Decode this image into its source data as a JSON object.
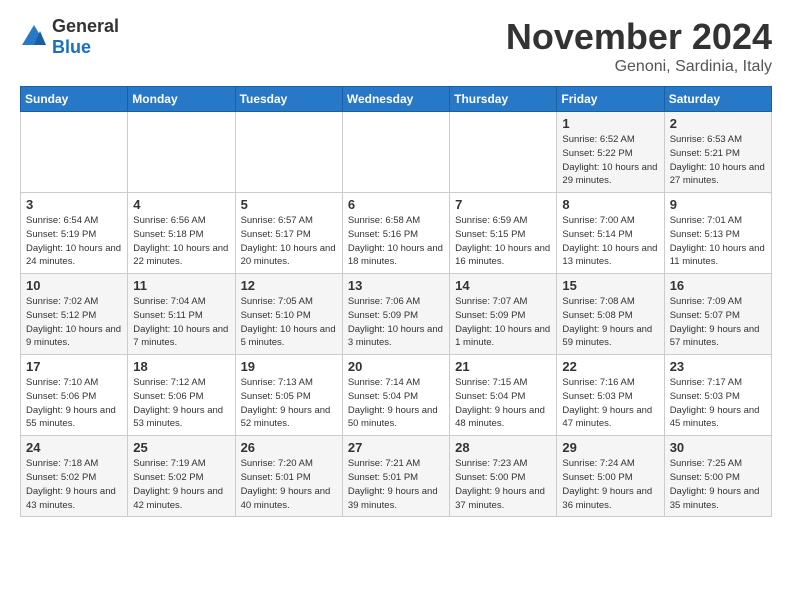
{
  "logo": {
    "general": "General",
    "blue": "Blue"
  },
  "title": "November 2024",
  "location": "Genoni, Sardinia, Italy",
  "days_of_week": [
    "Sunday",
    "Monday",
    "Tuesday",
    "Wednesday",
    "Thursday",
    "Friday",
    "Saturday"
  ],
  "weeks": [
    [
      {
        "day": "",
        "content": ""
      },
      {
        "day": "",
        "content": ""
      },
      {
        "day": "",
        "content": ""
      },
      {
        "day": "",
        "content": ""
      },
      {
        "day": "",
        "content": ""
      },
      {
        "day": "1",
        "content": "Sunrise: 6:52 AM\nSunset: 5:22 PM\nDaylight: 10 hours and 29 minutes."
      },
      {
        "day": "2",
        "content": "Sunrise: 6:53 AM\nSunset: 5:21 PM\nDaylight: 10 hours and 27 minutes."
      }
    ],
    [
      {
        "day": "3",
        "content": "Sunrise: 6:54 AM\nSunset: 5:19 PM\nDaylight: 10 hours and 24 minutes."
      },
      {
        "day": "4",
        "content": "Sunrise: 6:56 AM\nSunset: 5:18 PM\nDaylight: 10 hours and 22 minutes."
      },
      {
        "day": "5",
        "content": "Sunrise: 6:57 AM\nSunset: 5:17 PM\nDaylight: 10 hours and 20 minutes."
      },
      {
        "day": "6",
        "content": "Sunrise: 6:58 AM\nSunset: 5:16 PM\nDaylight: 10 hours and 18 minutes."
      },
      {
        "day": "7",
        "content": "Sunrise: 6:59 AM\nSunset: 5:15 PM\nDaylight: 10 hours and 16 minutes."
      },
      {
        "day": "8",
        "content": "Sunrise: 7:00 AM\nSunset: 5:14 PM\nDaylight: 10 hours and 13 minutes."
      },
      {
        "day": "9",
        "content": "Sunrise: 7:01 AM\nSunset: 5:13 PM\nDaylight: 10 hours and 11 minutes."
      }
    ],
    [
      {
        "day": "10",
        "content": "Sunrise: 7:02 AM\nSunset: 5:12 PM\nDaylight: 10 hours and 9 minutes."
      },
      {
        "day": "11",
        "content": "Sunrise: 7:04 AM\nSunset: 5:11 PM\nDaylight: 10 hours and 7 minutes."
      },
      {
        "day": "12",
        "content": "Sunrise: 7:05 AM\nSunset: 5:10 PM\nDaylight: 10 hours and 5 minutes."
      },
      {
        "day": "13",
        "content": "Sunrise: 7:06 AM\nSunset: 5:09 PM\nDaylight: 10 hours and 3 minutes."
      },
      {
        "day": "14",
        "content": "Sunrise: 7:07 AM\nSunset: 5:09 PM\nDaylight: 10 hours and 1 minute."
      },
      {
        "day": "15",
        "content": "Sunrise: 7:08 AM\nSunset: 5:08 PM\nDaylight: 9 hours and 59 minutes."
      },
      {
        "day": "16",
        "content": "Sunrise: 7:09 AM\nSunset: 5:07 PM\nDaylight: 9 hours and 57 minutes."
      }
    ],
    [
      {
        "day": "17",
        "content": "Sunrise: 7:10 AM\nSunset: 5:06 PM\nDaylight: 9 hours and 55 minutes."
      },
      {
        "day": "18",
        "content": "Sunrise: 7:12 AM\nSunset: 5:06 PM\nDaylight: 9 hours and 53 minutes."
      },
      {
        "day": "19",
        "content": "Sunrise: 7:13 AM\nSunset: 5:05 PM\nDaylight: 9 hours and 52 minutes."
      },
      {
        "day": "20",
        "content": "Sunrise: 7:14 AM\nSunset: 5:04 PM\nDaylight: 9 hours and 50 minutes."
      },
      {
        "day": "21",
        "content": "Sunrise: 7:15 AM\nSunset: 5:04 PM\nDaylight: 9 hours and 48 minutes."
      },
      {
        "day": "22",
        "content": "Sunrise: 7:16 AM\nSunset: 5:03 PM\nDaylight: 9 hours and 47 minutes."
      },
      {
        "day": "23",
        "content": "Sunrise: 7:17 AM\nSunset: 5:03 PM\nDaylight: 9 hours and 45 minutes."
      }
    ],
    [
      {
        "day": "24",
        "content": "Sunrise: 7:18 AM\nSunset: 5:02 PM\nDaylight: 9 hours and 43 minutes."
      },
      {
        "day": "25",
        "content": "Sunrise: 7:19 AM\nSunset: 5:02 PM\nDaylight: 9 hours and 42 minutes."
      },
      {
        "day": "26",
        "content": "Sunrise: 7:20 AM\nSunset: 5:01 PM\nDaylight: 9 hours and 40 minutes."
      },
      {
        "day": "27",
        "content": "Sunrise: 7:21 AM\nSunset: 5:01 PM\nDaylight: 9 hours and 39 minutes."
      },
      {
        "day": "28",
        "content": "Sunrise: 7:23 AM\nSunset: 5:00 PM\nDaylight: 9 hours and 37 minutes."
      },
      {
        "day": "29",
        "content": "Sunrise: 7:24 AM\nSunset: 5:00 PM\nDaylight: 9 hours and 36 minutes."
      },
      {
        "day": "30",
        "content": "Sunrise: 7:25 AM\nSunset: 5:00 PM\nDaylight: 9 hours and 35 minutes."
      }
    ]
  ]
}
